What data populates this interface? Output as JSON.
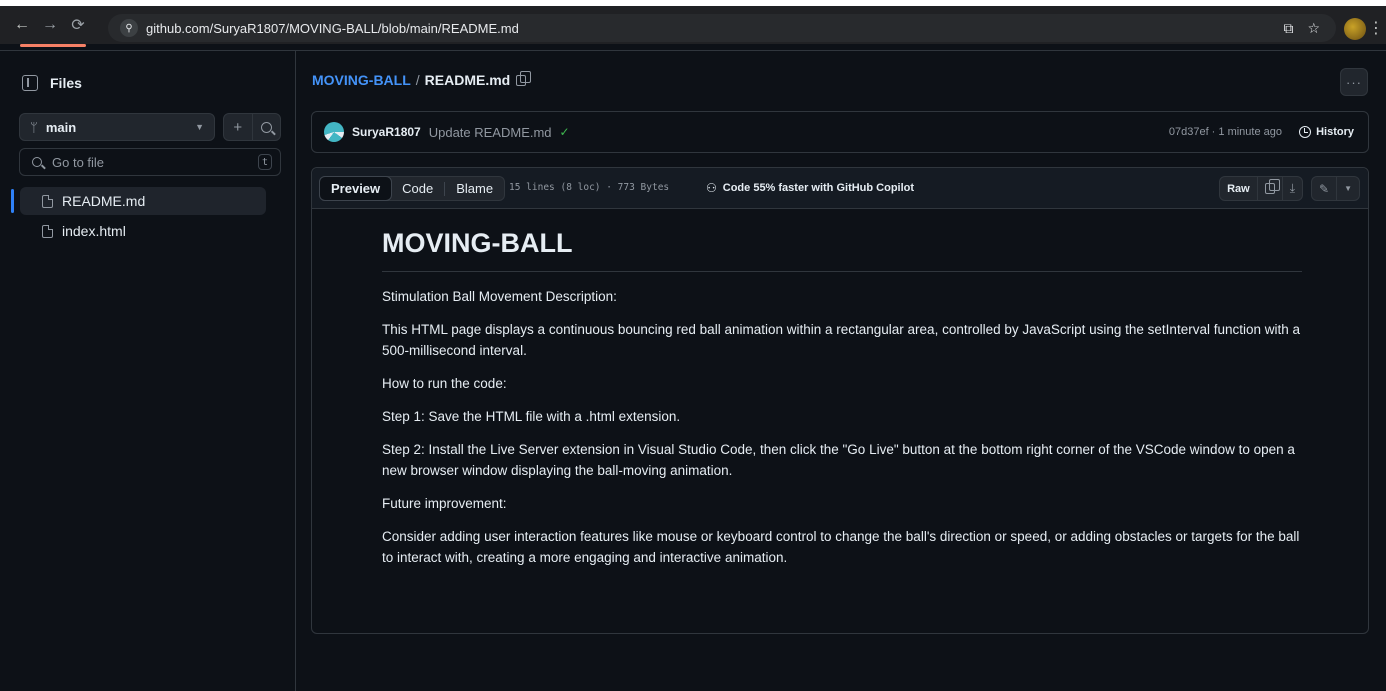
{
  "browser": {
    "url": "github.com/SuryaR1807/MOVING-BALL/blob/main/README.md"
  },
  "sidebar": {
    "title": "Files",
    "branch": "main",
    "search_placeholder": "Go to file",
    "search_shortcut": "t",
    "files": [
      {
        "name": "README.md",
        "active": true
      },
      {
        "name": "index.html",
        "active": false
      }
    ]
  },
  "breadcrumb": {
    "repo": "MOVING-BALL",
    "separator": "/",
    "file": "README.md"
  },
  "commit": {
    "author": "SuryaR1807",
    "message": "Update README.md",
    "meta": "07d37ef · 1 minute ago",
    "history_label": "History"
  },
  "toolbar": {
    "tabs": [
      "Preview",
      "Code",
      "Blame"
    ],
    "active_tab": "Preview",
    "file_info": "15 lines (8 loc) · 773 Bytes",
    "copilot": "Code 55% faster with GitHub Copilot",
    "raw_label": "Raw"
  },
  "readme": {
    "title": "MOVING-BALL",
    "paragraphs": [
      "Stimulation Ball Movement Description:",
      "This HTML page displays a continuous bouncing red ball animation within a rectangular area, controlled by JavaScript using the setInterval function with a 500-millisecond interval.",
      "How to run the code:",
      "Step 1: Save the HTML file with a .html extension.",
      "Step 2: Install the Live Server extension in Visual Studio Code, then click the \"Go Live\" button at the bottom right corner of the VSCode window to open a new browser window displaying the ball-moving animation.",
      "Future improvement:",
      "Consider adding user interaction features like mouse or keyboard control to change the ball's direction or speed, or adding obstacles or targets for the ball to interact with, creating a more engaging and interactive animation."
    ]
  },
  "colors": {
    "background": "#0d1117",
    "link": "#4493f8",
    "accent": "#f78166",
    "success": "#3fb950"
  }
}
